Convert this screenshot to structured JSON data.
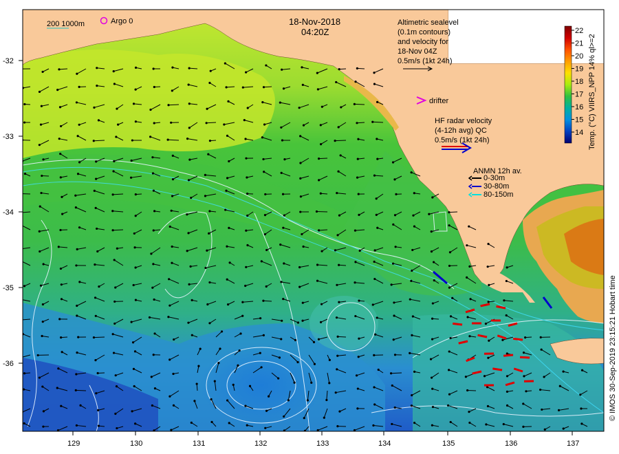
{
  "title": {
    "date": "18-Nov-2018",
    "time": "04:20Z"
  },
  "scale_legend": {
    "isobaths": "200  1000m",
    "argo": "Argo 0"
  },
  "altimetry_note": {
    "line1": "Altimetric sealevel",
    "line2": "(0.1m contours)",
    "line3": "and velocity for",
    "line4": "18-Nov 04Z",
    "line5": "0.5m/s (1kt 24h)"
  },
  "drifter_label": "drifter",
  "hf_radar_note": {
    "line1": "HF radar velocity",
    "line2": "(4-12h avg) QC",
    "line3": "0.5m/s (1kt 24h)"
  },
  "anmn_legend": {
    "title": "ANMN 12h av.",
    "items": [
      {
        "label": "0-30m",
        "color": "#000000"
      },
      {
        "label": "30-80m",
        "color": "#0000cc"
      },
      {
        "label": "80-150m",
        "color": "#00e0e0"
      }
    ]
  },
  "colorbar": {
    "label": "Temp. (°C) VIIRS_NPP 14% ql>=2",
    "ticks": [
      "22",
      "21",
      "20",
      "19",
      "18",
      "17",
      "16",
      "15",
      "14"
    ],
    "colors": [
      "#7f0000",
      "#c40000",
      "#ff3300",
      "#ff8c00",
      "#ffd000",
      "#c8f000",
      "#5ad000",
      "#00b070",
      "#00a0c0",
      "#0060e0",
      "#0000a0",
      "#000060"
    ]
  },
  "credit": "© IMOS 30-Sep-2019 23:15:21 Hobart time",
  "axes": {
    "x_ticks": [
      "129",
      "130",
      "131",
      "132",
      "133",
      "134",
      "135",
      "136",
      "137"
    ],
    "y_ticks": [
      "-32",
      "-33",
      "-34",
      "-35",
      "-36"
    ]
  },
  "colors": {
    "land": "#f9c99a",
    "shelf_green": "#3ec23a",
    "warm_yellow": "#c8ea28",
    "cool_blue": "#2a8ad8",
    "radar_red": "#e00000",
    "contour": "#e8f4ff"
  }
}
